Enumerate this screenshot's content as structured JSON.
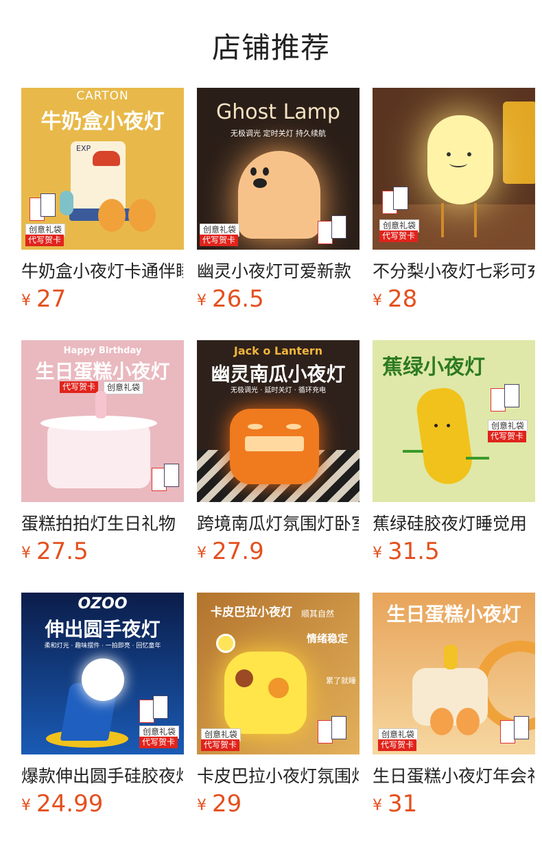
{
  "header": {
    "title": "店铺推荐"
  },
  "currency_symbol": "¥",
  "badges": {
    "gift_bag": "创意礼袋",
    "greeting_card": "代写贺卡"
  },
  "products": [
    {
      "name": "牛奶盒小夜灯卡通伴睡灯",
      "price": "27",
      "thumb": {
        "title": "牛奶盒小夜灯",
        "top": "CARTON",
        "label": "EXP",
        "bg": "#e8b94a"
      }
    },
    {
      "name": "幽灵小夜灯可爱新款",
      "price": "26.5",
      "thumb": {
        "title": "Ghost Lamp",
        "sub": "无极调光 定时关灯 持久续航",
        "bg": "#2a1e18"
      }
    },
    {
      "name": "不分梨小夜灯七彩可充电",
      "price": "28",
      "thumb": {
        "bg": "#5a3420"
      }
    },
    {
      "name": "蛋糕拍拍灯生日礼物",
      "price": "27.5",
      "thumb": {
        "title": "生日蛋糕小夜灯",
        "top": "Happy Birthday",
        "bg": "#e9b9bf"
      }
    },
    {
      "name": "跨境南瓜灯氛围灯卧室",
      "price": "27.9",
      "thumb": {
        "title": "幽灵南瓜小夜灯",
        "top": "Jack o Lantern",
        "sub": "无极调光 · 延时关灯 · 循环充电",
        "bg": "#2e211b"
      }
    },
    {
      "name": "蕉绿硅胶夜灯睡觉用",
      "price": "31.5",
      "thumb": {
        "title": "蕉绿小夜灯",
        "bg": "#dfe8a8"
      }
    },
    {
      "name": "爆款伸出圆手硅胶夜灯",
      "price": "24.99",
      "thumb": {
        "title": "伸出圆手夜灯",
        "top": "OZOO",
        "sub": "柔和灯光 · 趣味摆件 · 一拍即亮 · 回忆童年",
        "bg": "#0d2a63"
      }
    },
    {
      "name": "卡皮巴拉小夜灯氛围灯",
      "price": "29",
      "thumb": {
        "title": "卡皮巴拉小夜灯",
        "sub": "顺其自然",
        "side": "情绪稳定",
        "side2": "累了就睡",
        "bg": "#c98a3e"
      }
    },
    {
      "name": "生日蛋糕小夜灯年会礼品",
      "price": "31",
      "thumb": {
        "title": "生日蛋糕小夜灯",
        "bg": "#f2c08a"
      }
    }
  ]
}
